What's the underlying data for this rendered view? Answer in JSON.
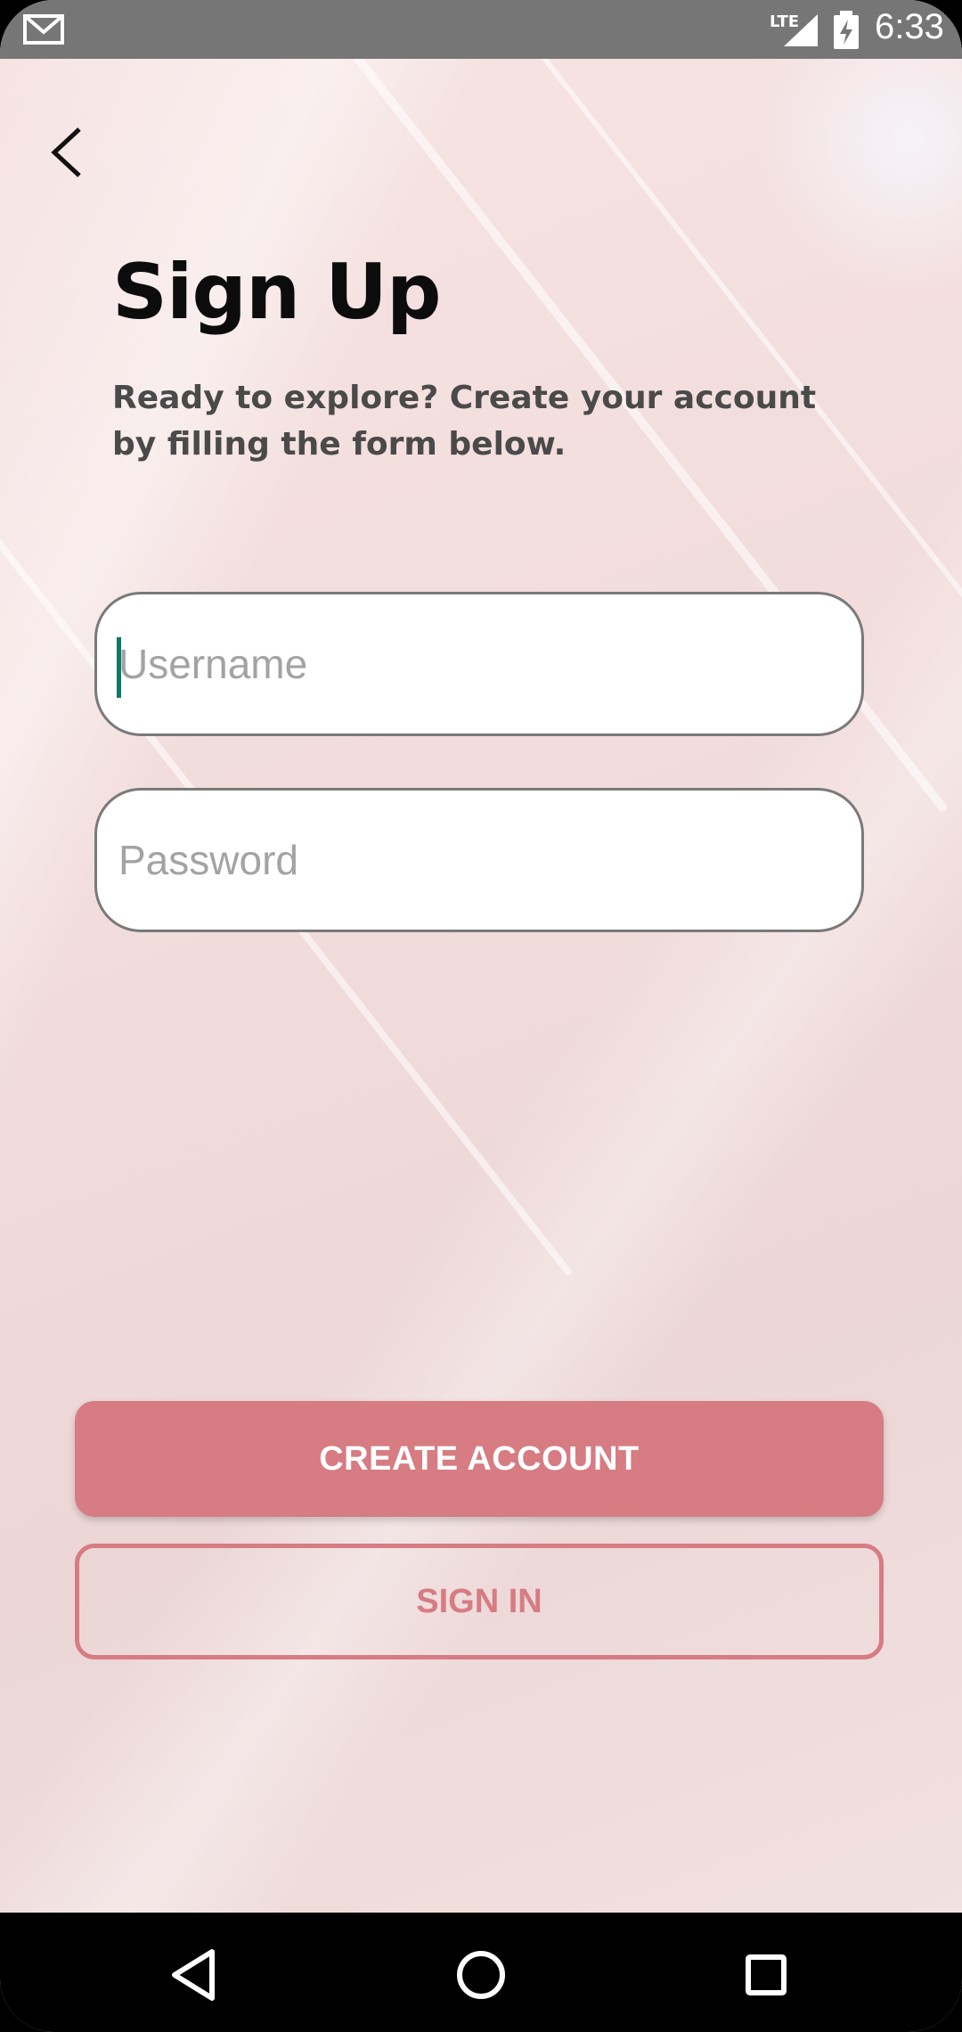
{
  "status_bar": {
    "network": "LTE",
    "time": "6:33"
  },
  "header": {
    "title": "Sign Up",
    "subtitle": "Ready to explore? Create your account by filling the form below."
  },
  "form": {
    "username": {
      "value": "",
      "placeholder": "Username"
    },
    "password": {
      "value": "",
      "placeholder": "Password"
    }
  },
  "actions": {
    "create_account_label": "CREATE ACCOUNT",
    "sign_in_label": "SIGN IN"
  },
  "colors": {
    "accent": "#d67c82",
    "caret": "#0f7a66"
  }
}
